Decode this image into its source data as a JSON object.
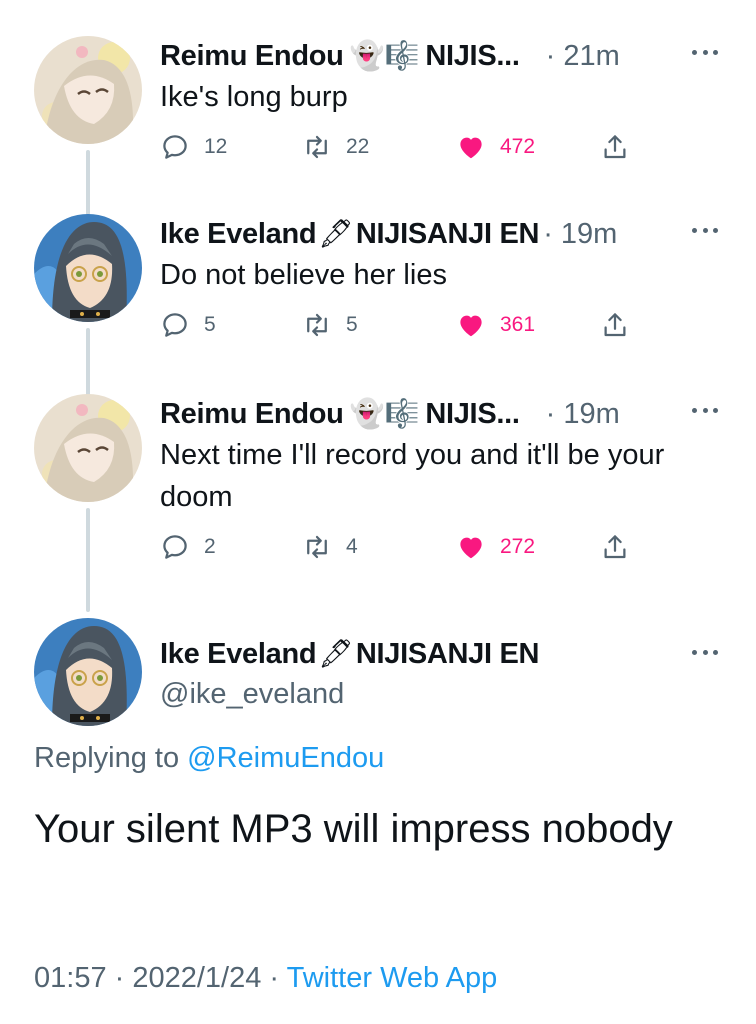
{
  "tweets": [
    {
      "name": "Reimu Endou",
      "badges": "👻🎼",
      "affiliation": "NIJIS...",
      "time": "· 21m",
      "text": "Ike's long burp",
      "replies": "12",
      "retweets": "22",
      "likes": "472"
    },
    {
      "name": "Ike Eveland",
      "badges": "🖋",
      "affiliation": "NIJISANJI EN",
      "time": "· 19m",
      "text": "Do not believe her lies",
      "replies": "5",
      "retweets": "5",
      "likes": "361"
    },
    {
      "name": "Reimu Endou",
      "badges": "👻🎼",
      "affiliation": "NIJIS...",
      "time": "· 19m",
      "text": "Next time I'll record you and it'll be your doom",
      "replies": "2",
      "retweets": "4",
      "likes": "272"
    }
  ],
  "main": {
    "name": "Ike Eveland",
    "badges": "🖋",
    "affiliation": "NIJISANJI EN",
    "handle": "@ike_eveland",
    "reply_prefix": "Replying to",
    "reply_handle": "@ReimuEndou",
    "text": "Your silent MP3 will impress nobody",
    "time": "01:57 · 2022/1/24 ·",
    "client": "Twitter Web App"
  },
  "icons": {
    "reply": "reply-icon",
    "retweet": "retweet-icon",
    "like": "heart-icon",
    "share": "share-icon",
    "more": "more-icon"
  },
  "colors": {
    "like": "#f91880",
    "link": "#1d9bf0",
    "muted": "#536471",
    "thread_line": "#cfd9de"
  }
}
